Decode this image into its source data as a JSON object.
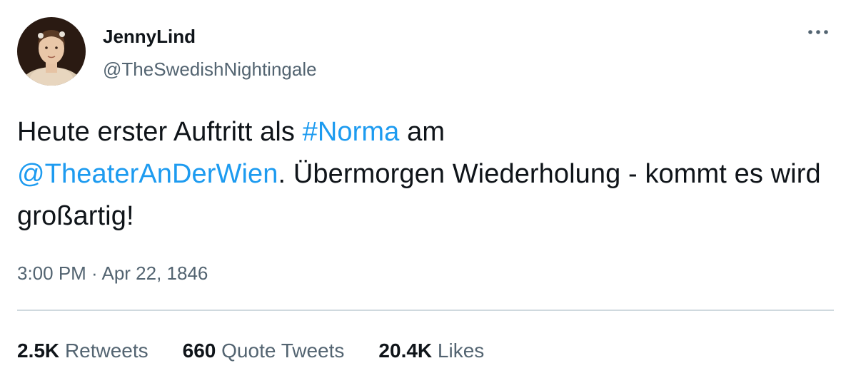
{
  "user": {
    "display_name": "JennyLind",
    "handle": "@TheSwedishNightingale"
  },
  "tweet": {
    "text_part1": "Heute erster Auftritt als ",
    "hashtag": "#Norma",
    "text_part2": " am",
    "mention": "@TheaterAnDerWien",
    "text_part3": ". Übermorgen Wiederholung - kommt es wird großartig!"
  },
  "timestamp": {
    "time": "3:00 PM",
    "separator": " · ",
    "date": "Apr 22, 1846"
  },
  "stats": {
    "retweets_count": "2.5K",
    "retweets_label": "Retweets",
    "quotes_count": "660",
    "quotes_label": "Quote Tweets",
    "likes_count": "20.4K",
    "likes_label": "Likes"
  },
  "colors": {
    "link": "#1d9bf0",
    "text": "#0f1419",
    "secondary": "#536471",
    "divider": "#cfd9de"
  },
  "icons": {
    "more": "more-dots-icon",
    "avatar": "avatar-portrait"
  }
}
